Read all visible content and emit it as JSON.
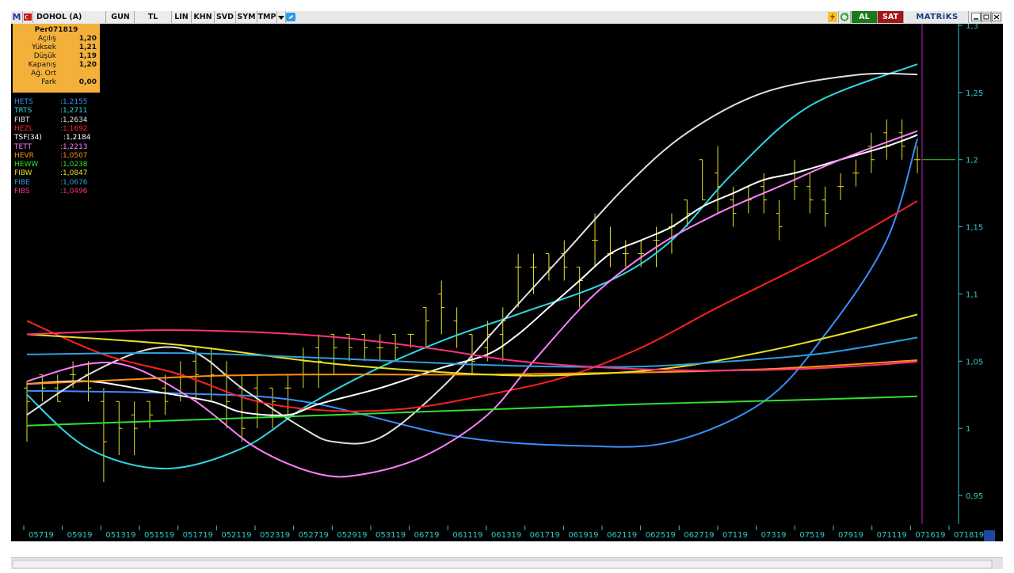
{
  "toolbar": {
    "logo": "M",
    "symbol": "DOHOL (A)",
    "tabs": [
      "GUN",
      "TL",
      "LIN",
      "KHN",
      "SVD",
      "SYM",
      "TMP"
    ],
    "al_label": "AL",
    "sat_label": "SAT",
    "brand": "MATRiKS"
  },
  "info": {
    "title": "Per071819",
    "rows": [
      {
        "label": "Açılış",
        "value": "1,20"
      },
      {
        "label": "Yüksek",
        "value": "1,21"
      },
      {
        "label": "Düşük",
        "value": "1,19"
      },
      {
        "label": "Kapanış",
        "value": "1,20"
      },
      {
        "label": "Ağ. Ort",
        "value": ""
      },
      {
        "label": "Fark",
        "value": "0,00"
      }
    ]
  },
  "legend": [
    {
      "name": "HETS",
      "value": ":1,2155",
      "color": "#3a8fff"
    },
    {
      "name": "TRTS",
      "value": ":1,2711",
      "color": "#2fd8e0"
    },
    {
      "name": "FIBT",
      "value": ":1,2634",
      "color": "#e0e0e0"
    },
    {
      "name": "HEZL",
      "value": ":1,1692",
      "color": "#ff2020"
    },
    {
      "name": "TSF(34)",
      "value": ":1,2184",
      "color": "#ffffff"
    },
    {
      "name": "TETT",
      "value": ":1,2213",
      "color": "#ff80ff"
    },
    {
      "name": "HEVR",
      "value": ":1,0507",
      "color": "#ff9010"
    },
    {
      "name": "HEWW",
      "value": ":1,0238",
      "color": "#30e030"
    },
    {
      "name": "FIBW",
      "value": ":1,0847",
      "color": "#e8e020"
    },
    {
      "name": "FIBE",
      "value": ":1,0676",
      "color": "#2aa0e0"
    },
    {
      "name": "FIBS",
      "value": ":1,0496",
      "color": "#ff3080"
    }
  ],
  "chart_data": {
    "type": "line",
    "ylim": [
      0.93,
      1.3
    ],
    "y_ticks": [
      "1,3",
      "1,25",
      "1,2",
      "1,15",
      "1,1",
      "1,05",
      "1",
      "0,95"
    ],
    "y_tick_values": [
      1.3,
      1.25,
      1.2,
      1.15,
      1.1,
      1.05,
      1.0,
      0.95
    ],
    "x_labels": [
      "05719",
      "05919",
      "051319",
      "051519",
      "051719",
      "052119",
      "052319",
      "052719",
      "052919",
      "053119",
      "06719",
      "061119",
      "061319",
      "061719",
      "061919",
      "062119",
      "062519",
      "062719",
      "07119",
      "07319",
      "07519",
      "07919",
      "071119",
      "071619",
      "071819"
    ],
    "current_price": 1.2,
    "bars": [
      [
        1.03,
        1.035,
        0.99,
        1.02
      ],
      [
        1.04,
        1.04,
        1.02,
        1.03
      ],
      [
        1.03,
        1.04,
        1.02,
        1.02
      ],
      [
        1.04,
        1.05,
        1.03,
        1.04
      ],
      [
        1.04,
        1.05,
        1.02,
        1.03
      ],
      [
        1.02,
        1.03,
        0.96,
        0.99
      ],
      [
        1.02,
        1.02,
        0.98,
        1.0
      ],
      [
        1.01,
        1.02,
        0.98,
        1.0
      ],
      [
        1.02,
        1.02,
        1.0,
        1.01
      ],
      [
        1.03,
        1.04,
        1.01,
        1.02
      ],
      [
        1.04,
        1.05,
        1.02,
        1.04
      ],
      [
        1.05,
        1.06,
        1.02,
        1.04
      ],
      [
        1.05,
        1.06,
        1.02,
        1.04
      ],
      [
        1.04,
        1.05,
        1.0,
        1.02
      ],
      [
        1.03,
        1.04,
        0.99,
        1.0
      ],
      [
        1.03,
        1.04,
        1.0,
        1.01
      ],
      [
        1.03,
        1.03,
        1.0,
        1.02
      ],
      [
        1.03,
        1.04,
        1.01,
        1.03
      ],
      [
        1.04,
        1.06,
        1.03,
        1.05
      ],
      [
        1.06,
        1.07,
        1.03,
        1.05
      ],
      [
        1.07,
        1.07,
        1.04,
        1.06
      ],
      [
        1.07,
        1.07,
        1.05,
        1.06
      ],
      [
        1.07,
        1.07,
        1.05,
        1.06
      ],
      [
        1.06,
        1.07,
        1.05,
        1.06
      ],
      [
        1.07,
        1.07,
        1.05,
        1.06
      ],
      [
        1.07,
        1.07,
        1.06,
        1.07
      ],
      [
        1.09,
        1.09,
        1.06,
        1.08
      ],
      [
        1.1,
        1.11,
        1.07,
        1.09
      ],
      [
        1.08,
        1.09,
        1.06,
        1.07
      ],
      [
        1.07,
        1.07,
        1.04,
        1.05
      ],
      [
        1.06,
        1.08,
        1.05,
        1.07
      ],
      [
        1.07,
        1.09,
        1.05,
        1.08
      ],
      [
        1.12,
        1.13,
        1.09,
        1.12
      ],
      [
        1.12,
        1.13,
        1.1,
        1.12
      ],
      [
        1.13,
        1.13,
        1.11,
        1.12
      ],
      [
        1.13,
        1.14,
        1.11,
        1.12
      ],
      [
        1.12,
        1.12,
        1.09,
        1.11
      ],
      [
        1.14,
        1.16,
        1.12,
        1.14
      ],
      [
        1.13,
        1.15,
        1.12,
        1.13
      ],
      [
        1.13,
        1.14,
        1.12,
        1.13
      ],
      [
        1.13,
        1.14,
        1.12,
        1.13
      ],
      [
        1.14,
        1.15,
        1.12,
        1.14
      ],
      [
        1.15,
        1.16,
        1.13,
        1.15
      ],
      [
        1.17,
        1.17,
        1.15,
        1.16
      ],
      [
        1.2,
        1.2,
        1.17,
        1.17
      ],
      [
        1.19,
        1.21,
        1.16,
        1.18
      ],
      [
        1.17,
        1.18,
        1.15,
        1.16
      ],
      [
        1.17,
        1.18,
        1.16,
        1.17
      ],
      [
        1.18,
        1.19,
        1.16,
        1.17
      ],
      [
        1.16,
        1.17,
        1.14,
        1.15
      ],
      [
        1.19,
        1.2,
        1.17,
        1.18
      ],
      [
        1.18,
        1.19,
        1.16,
        1.17
      ],
      [
        1.17,
        1.18,
        1.15,
        1.16
      ],
      [
        1.18,
        1.19,
        1.17,
        1.18
      ],
      [
        1.19,
        1.2,
        1.18,
        1.19
      ],
      [
        1.21,
        1.22,
        1.19,
        1.2
      ],
      [
        1.22,
        1.23,
        1.2,
        1.21
      ],
      [
        1.22,
        1.23,
        1.2,
        1.21
      ],
      [
        1.2,
        1.21,
        1.19,
        1.2
      ]
    ],
    "series": [
      {
        "name": "HETS",
        "color": "#3a8fff",
        "values": [
          [
            0,
            1.028
          ],
          [
            10,
            1.026
          ],
          [
            18,
            1.02
          ],
          [
            28,
            0.994
          ],
          [
            36,
            0.987
          ],
          [
            42,
            0.99
          ],
          [
            48,
            1.02
          ],
          [
            52,
            1.07
          ],
          [
            56,
            1.14
          ],
          [
            58,
            1.2155
          ]
        ]
      },
      {
        "name": "TRTS",
        "color": "#2fd8e0",
        "values": [
          [
            0,
            1.025
          ],
          [
            4,
            0.985
          ],
          [
            9,
            0.97
          ],
          [
            14,
            0.985
          ],
          [
            18,
            1.015
          ],
          [
            22,
            1.04
          ],
          [
            27,
            1.065
          ],
          [
            32,
            1.085
          ],
          [
            38,
            1.11
          ],
          [
            42,
            1.14
          ],
          [
            46,
            1.19
          ],
          [
            51,
            1.24
          ],
          [
            58,
            1.2711
          ]
        ]
      },
      {
        "name": "FIBT",
        "color": "#e0e0e0",
        "values": [
          [
            0,
            1.01
          ],
          [
            4,
            1.04
          ],
          [
            8,
            1.059
          ],
          [
            11,
            1.056
          ],
          [
            14,
            1.03
          ],
          [
            18,
            1.0
          ],
          [
            20,
            0.99
          ],
          [
            23,
            0.993
          ],
          [
            27,
            1.03
          ],
          [
            31,
            1.08
          ],
          [
            35,
            1.13
          ],
          [
            39,
            1.18
          ],
          [
            43,
            1.22
          ],
          [
            48,
            1.25
          ],
          [
            54,
            1.263
          ],
          [
            58,
            1.2634
          ]
        ]
      },
      {
        "name": "HEZL",
        "color": "#ff2020",
        "values": [
          [
            0,
            1.08
          ],
          [
            5,
            1.055
          ],
          [
            10,
            1.04
          ],
          [
            15,
            1.02
          ],
          [
            20,
            1.013
          ],
          [
            25,
            1.015
          ],
          [
            30,
            1.025
          ],
          [
            35,
            1.038
          ],
          [
            40,
            1.06
          ],
          [
            45,
            1.09
          ],
          [
            52,
            1.13
          ],
          [
            58,
            1.1692
          ]
        ]
      },
      {
        "name": "TSF(34)",
        "color": "#ffffff",
        "values": [
          [
            0,
            1.033
          ],
          [
            4,
            1.035
          ],
          [
            8,
            1.028
          ],
          [
            12,
            1.02
          ],
          [
            14,
            1.012
          ],
          [
            17,
            1.01
          ],
          [
            19,
            1.018
          ],
          [
            23,
            1.03
          ],
          [
            27,
            1.045
          ],
          [
            30,
            1.055
          ],
          [
            32,
            1.07
          ],
          [
            34,
            1.09
          ],
          [
            36,
            1.11
          ],
          [
            38,
            1.13
          ],
          [
            40,
            1.14
          ],
          [
            42,
            1.15
          ],
          [
            44,
            1.165
          ],
          [
            46,
            1.175
          ],
          [
            48,
            1.185
          ],
          [
            50,
            1.19
          ],
          [
            53,
            1.2
          ],
          [
            56,
            1.21
          ],
          [
            58,
            1.2184
          ]
        ]
      },
      {
        "name": "TETT",
        "color": "#ff80ff",
        "values": [
          [
            0,
            1.035
          ],
          [
            4,
            1.048
          ],
          [
            7,
            1.045
          ],
          [
            11,
            1.02
          ],
          [
            15,
            0.985
          ],
          [
            19,
            0.966
          ],
          [
            22,
            0.966
          ],
          [
            26,
            0.98
          ],
          [
            30,
            1.01
          ],
          [
            33,
            1.05
          ],
          [
            37,
            1.1
          ],
          [
            41,
            1.135
          ],
          [
            45,
            1.16
          ],
          [
            49,
            1.18
          ],
          [
            53,
            1.2
          ],
          [
            58,
            1.2213
          ]
        ]
      },
      {
        "name": "HEVR",
        "color": "#ff9010",
        "values": [
          [
            0,
            1.033
          ],
          [
            6,
            1.036
          ],
          [
            12,
            1.039
          ],
          [
            18,
            1.04
          ],
          [
            24,
            1.04
          ],
          [
            30,
            1.04
          ],
          [
            36,
            1.041
          ],
          [
            42,
            1.042
          ],
          [
            48,
            1.044
          ],
          [
            53,
            1.047
          ],
          [
            58,
            1.0507
          ]
        ]
      },
      {
        "name": "HEWW",
        "color": "#30e030",
        "values": [
          [
            0,
            1.002
          ],
          [
            10,
            1.006
          ],
          [
            20,
            1.01
          ],
          [
            30,
            1.014
          ],
          [
            40,
            1.018
          ],
          [
            50,
            1.021
          ],
          [
            58,
            1.0238
          ]
        ]
      },
      {
        "name": "FIBW",
        "color": "#e8e020",
        "values": [
          [
            0,
            1.07
          ],
          [
            10,
            1.062
          ],
          [
            20,
            1.048
          ],
          [
            30,
            1.04
          ],
          [
            36,
            1.04
          ],
          [
            42,
            1.045
          ],
          [
            48,
            1.057
          ],
          [
            53,
            1.07
          ],
          [
            58,
            1.0847
          ]
        ]
      },
      {
        "name": "FIBE",
        "color": "#2aa0e0",
        "values": [
          [
            0,
            1.055
          ],
          [
            10,
            1.056
          ],
          [
            20,
            1.052
          ],
          [
            28,
            1.048
          ],
          [
            34,
            1.046
          ],
          [
            40,
            1.046
          ],
          [
            46,
            1.05
          ],
          [
            52,
            1.056
          ],
          [
            58,
            1.0676
          ]
        ]
      },
      {
        "name": "FIBS",
        "color": "#ff3080",
        "values": [
          [
            0,
            1.07
          ],
          [
            8,
            1.073
          ],
          [
            14,
            1.072
          ],
          [
            20,
            1.068
          ],
          [
            26,
            1.06
          ],
          [
            32,
            1.05
          ],
          [
            38,
            1.045
          ],
          [
            44,
            1.043
          ],
          [
            50,
            1.044
          ],
          [
            55,
            1.047
          ],
          [
            58,
            1.0496
          ]
        ]
      }
    ]
  }
}
